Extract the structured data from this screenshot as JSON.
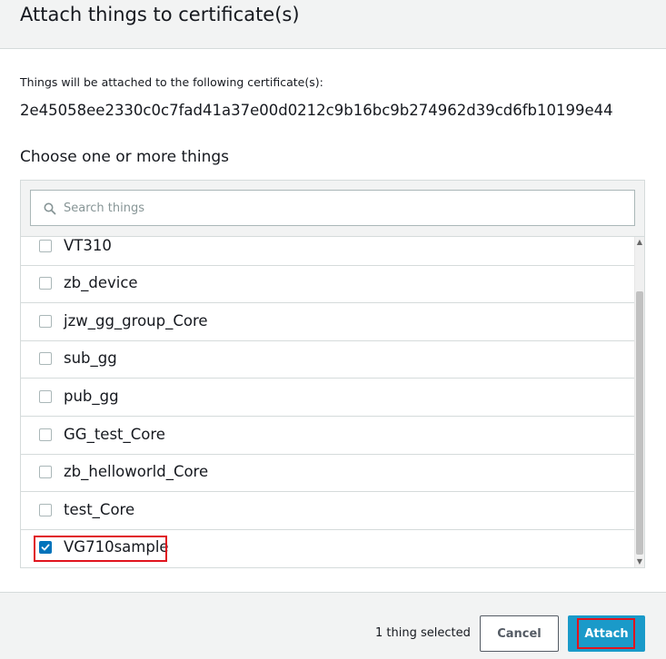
{
  "modal": {
    "title": "Attach things to certificate(s)"
  },
  "intro": {
    "text": "Things will be attached to the following certificate(s):",
    "certificate_id": "2e45058ee2330c0c7fad41a37e00d0212c9b16bc9b274962d39cd6fb10199e44"
  },
  "section": {
    "title": "Choose one or more things"
  },
  "search": {
    "placeholder": "Search things",
    "value": "",
    "icon": "search-icon"
  },
  "things": [
    {
      "label": "VT310",
      "checked": false
    },
    {
      "label": "zb_device",
      "checked": false
    },
    {
      "label": "jzw_gg_group_Core",
      "checked": false
    },
    {
      "label": "sub_gg",
      "checked": false
    },
    {
      "label": "pub_gg",
      "checked": false
    },
    {
      "label": "GG_test_Core",
      "checked": false
    },
    {
      "label": "zb_helloworld_Core",
      "checked": false
    },
    {
      "label": "test_Core",
      "checked": false
    },
    {
      "label": "VG710sample",
      "checked": true
    }
  ],
  "footer": {
    "selected_text": "1 thing selected",
    "cancel_label": "Cancel",
    "attach_label": "Attach"
  },
  "colors": {
    "primary": "#1a9ac9",
    "checkbox_checked": "#0073bb",
    "highlight": "#e0141e",
    "header_bg": "#f2f3f3"
  }
}
